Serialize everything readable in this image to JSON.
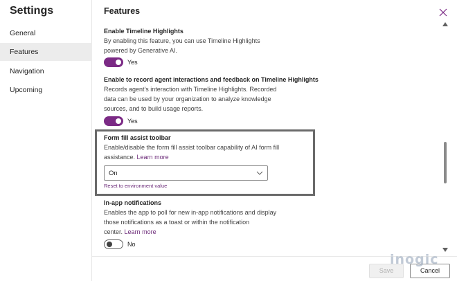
{
  "sidebar": {
    "title": "Settings",
    "items": [
      {
        "label": "General"
      },
      {
        "label": "Features"
      },
      {
        "label": "Navigation"
      },
      {
        "label": "Upcoming"
      }
    ]
  },
  "main": {
    "title": "Features",
    "sections": [
      {
        "title": "Enable Timeline Highlights",
        "desc_lines": [
          "By enabling this feature, you can use Timeline Highlights",
          "powered by Generative AI."
        ],
        "toggle_state": "on",
        "toggle_label": "Yes"
      },
      {
        "title": "Enable to record agent interactions and feedback on Timeline Highlights",
        "desc_lines": [
          "Records agent's interaction with Timeline Highlights. Recorded",
          "data can be used by your organization to analyze knowledge",
          "sources, and to build usage reports."
        ],
        "toggle_state": "on",
        "toggle_label": "Yes"
      },
      {
        "title": "Form fill assist toolbar",
        "desc_lines": [
          "Enable/disable the form fill assist toolbar capability of AI form fill"
        ],
        "desc_line2_prefix": "assistance.",
        "link": "Learn more",
        "select_value": "On",
        "reset_link": "Reset to environment value"
      },
      {
        "title": "In-app notifications",
        "desc_lines": [
          "Enables the app to poll for new in-app notifications and display",
          "those notifications as a toast or within the notification"
        ],
        "desc_line3_prefix": "center.",
        "link": "Learn more",
        "toggle_state": "off",
        "toggle_label": "No"
      }
    ]
  },
  "footer": {
    "save_label": "Save",
    "cancel_label": "Cancel",
    "watermark": "inogic"
  },
  "colors": {
    "accent": "#7b2a85",
    "link": "#6b2a78",
    "highlight_border": "#6a6a6a"
  }
}
